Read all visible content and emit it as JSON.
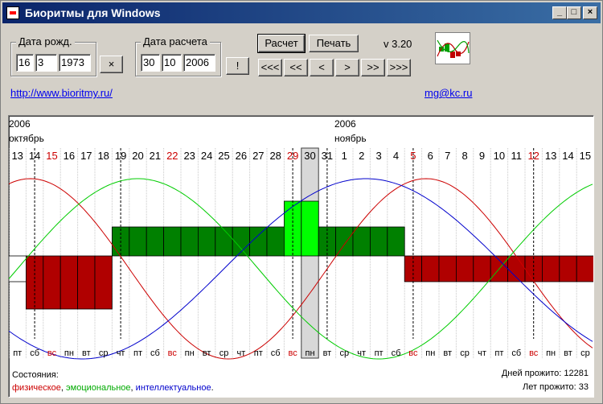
{
  "window": {
    "title": "Биоритмы для Windows",
    "controls": [
      "_",
      "□",
      "×"
    ]
  },
  "birth": {
    "label": "Дата рожд.",
    "day": "16",
    "month": "3",
    "year": "1973",
    "clear_button": "×"
  },
  "calc": {
    "label": "Дата расчета",
    "day": "30",
    "month": "10",
    "year": "2006",
    "today_button": "!"
  },
  "toolbar": {
    "calc_button": "Расчет",
    "print_button": "Печать",
    "version": "v 3.20"
  },
  "nav": [
    "<<<",
    "<<",
    "<",
    ">",
    ">>",
    ">>>"
  ],
  "links": {
    "site": "http://www.bioritmy.ru/",
    "email": "mg@kc.ru"
  },
  "chart": {
    "year_left": "2006",
    "month_left": "октябрь",
    "year_right": "2006",
    "month_right": "ноябрь",
    "days": [
      "13",
      "14",
      "15",
      "16",
      "17",
      "18",
      "19",
      "20",
      "21",
      "22",
      "23",
      "24",
      "25",
      "26",
      "27",
      "28",
      "29",
      "30",
      "31",
      "1",
      "2",
      "3",
      "4",
      "5",
      "6",
      "7",
      "8",
      "9",
      "10",
      "11",
      "12",
      "13",
      "14",
      "15"
    ],
    "weekdays": [
      "пт",
      "сб",
      "вс",
      "пн",
      "вт",
      "ср",
      "чт",
      "пт",
      "сб",
      "вс",
      "пн",
      "вт",
      "ср",
      "чт",
      "пт",
      "сб",
      "вс",
      "пн",
      "вт",
      "ср",
      "чт",
      "пт",
      "сб",
      "вс",
      "пн",
      "вт",
      "ср",
      "чт",
      "пт",
      "сб",
      "вс",
      "пн",
      "вт",
      "ср"
    ],
    "red_days": [
      "15",
      "22",
      "29",
      "5",
      "12"
    ],
    "selected_day": "30",
    "colors": {
      "physical": "#cc0000",
      "emotional": "#00cc00",
      "intellectual": "#0000cc",
      "bar_green": "#008000",
      "bar_red": "#b00000",
      "bar_highlight": "#00ff00"
    }
  },
  "footer": {
    "states_label": "Состояния:",
    "physical": "физическое",
    "emotional": "эмоциональное",
    "intellectual": "интеллектуальное",
    "sep1": ", ",
    "sep2": ", ",
    "end": ".",
    "days_lived": "Дней прожито: 12281",
    "years_lived": "Лет прожито: 33"
  }
}
